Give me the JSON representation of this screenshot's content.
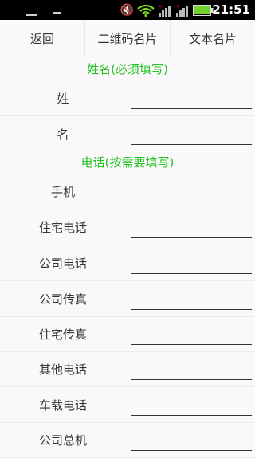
{
  "status_bar": {
    "time": "21:51"
  },
  "tabs": [
    "返回",
    "二维码名片",
    "文本名片"
  ],
  "sections": {
    "name_title": "姓名(必须填写)",
    "phone_title": "电话(按需要填写)"
  },
  "name_fields": [
    {
      "label": "姓",
      "value": ""
    },
    {
      "label": "名",
      "value": ""
    }
  ],
  "phone_fields": [
    {
      "label": "手机",
      "value": ""
    },
    {
      "label": "住宅电话",
      "value": ""
    },
    {
      "label": "公司电话",
      "value": ""
    },
    {
      "label": "公司传真",
      "value": ""
    },
    {
      "label": "住宅传真",
      "value": ""
    },
    {
      "label": "其他电话",
      "value": ""
    },
    {
      "label": "车载电话",
      "value": ""
    },
    {
      "label": "公司总机",
      "value": ""
    }
  ]
}
